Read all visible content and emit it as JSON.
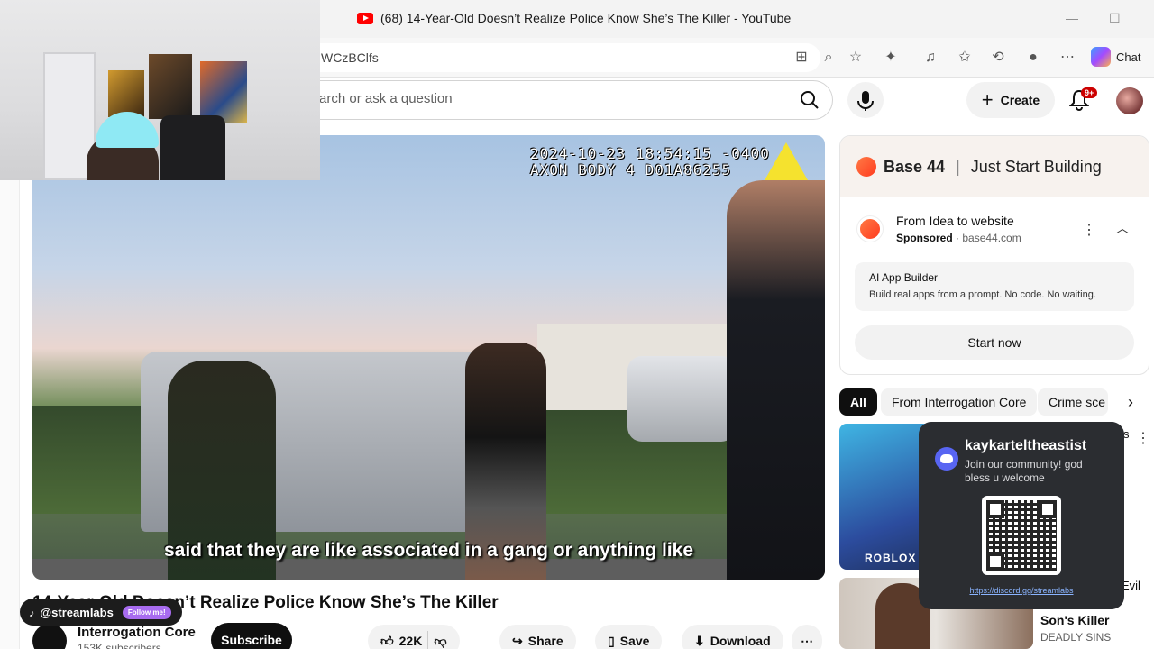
{
  "browser": {
    "tab_title": "(68) 14-Year-Old Doesn’t Realize Police Know She’s The Killer - YouTube",
    "url_fragment": "WCzBClfs",
    "chat_label": "Chat",
    "minimize": "—",
    "maximize": "☐"
  },
  "header": {
    "search_placeholder": "arch or ask a question",
    "create_label": "Create",
    "notifications_badge": "9+"
  },
  "video": {
    "osd_line1": "2024-10-23 18:54:15 -0400",
    "osd_line2": "AXON BODY 4 D01A86255",
    "caption": "said that they are like associated in a gang or anything like",
    "title": "14-Year-Old Doesn’t Realize Police Know She’s The Killer"
  },
  "channel": {
    "name": "Interrogation Core",
    "subscribers": "153K subscribers",
    "subscribe_label": "Subscribe"
  },
  "actions": {
    "likes": "22K",
    "share": "Share",
    "save": "Save",
    "download": "Download",
    "more": "⋯"
  },
  "overlay_tiktok": {
    "handle": "@streamlabs",
    "follow": "Follow me!"
  },
  "ad": {
    "brand": "Base 44",
    "tagline": "Just Start Building",
    "headline": "From Idea to website",
    "sponsored": "Sponsored",
    "domain": "base44.com",
    "box_title": "AI App Builder",
    "box_desc": "Build real apps from a prompt. No code. No waiting.",
    "cta": "Start now"
  },
  "chips": [
    {
      "label": "All",
      "active": true
    },
    {
      "label": "From Interrogation Core",
      "active": false
    },
    {
      "label": "Crime sce",
      "active": false
    }
  ],
  "recommended": {
    "thumb1_text": "ROBLOX",
    "item2_title": "Son's Killer",
    "item2_channel": "DEADLY SINS",
    "item2_suffix": "Evil",
    "item1_suffix": "s"
  },
  "discord": {
    "name": "kaykarteltheastist",
    "message": "Join our community! god bless u welcome",
    "link": "https://discord.gg/streamlabs"
  }
}
